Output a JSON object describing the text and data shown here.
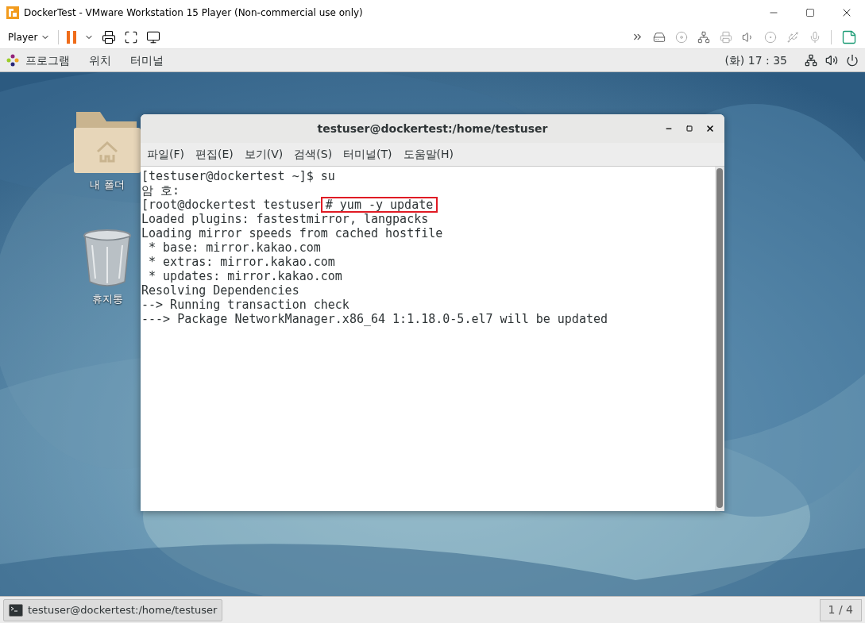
{
  "vm_window": {
    "title": "DockerTest - VMware Workstation 15 Player (Non-commercial use only)"
  },
  "vm_toolbar": {
    "player_menu": "Player"
  },
  "gnome_top_bar": {
    "menus": [
      "프로그램",
      "위치",
      "터미널"
    ],
    "clock": "(화) 17 : 35"
  },
  "desktop_icons": [
    {
      "label": "내 폴더",
      "kind": "home-folder"
    },
    {
      "label": "휴지통",
      "kind": "trash"
    }
  ],
  "terminal": {
    "title": "testuser@dockertest:/home/testuser",
    "menu": [
      "파일(F)",
      "편집(E)",
      "보기(V)",
      "검색(S)",
      "터미널(T)",
      "도움말(H)"
    ],
    "lines": [
      {
        "text": "[testuser@dockertest ~]$ su"
      },
      {
        "text": "암 호:"
      },
      {
        "text": "[root@dockertest testuser",
        "highlight": "# yum -y update"
      },
      {
        "text": "Loaded plugins: fastestmirror, langpacks"
      },
      {
        "text": "Loading mirror speeds from cached hostfile"
      },
      {
        "text": " * base: mirror.kakao.com"
      },
      {
        "text": " * extras: mirror.kakao.com"
      },
      {
        "text": " * updates: mirror.kakao.com"
      },
      {
        "text": "Resolving Dependencies"
      },
      {
        "text": "--> Running transaction check"
      },
      {
        "text": "---> Package NetworkManager.x86_64 1:1.18.0-5.el7 will be updated"
      }
    ]
  },
  "taskbar": {
    "window_button": "testuser@dockertest:/home/testuser",
    "workspace": "1 / 4"
  }
}
